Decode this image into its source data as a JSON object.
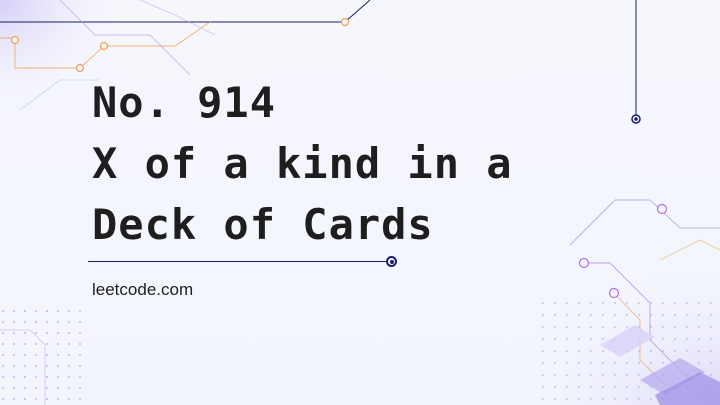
{
  "card": {
    "title_lines": [
      "No. 914",
      "X of a kind in a",
      "Deck of Cards"
    ],
    "website": "leetcode.com"
  },
  "colors": {
    "background": "#f4f6fd",
    "text": "#1e1e1e",
    "navy_accent": "#1a1d6b",
    "purple_accent": "#b46ee6",
    "orange_accent": "#f0a050"
  }
}
